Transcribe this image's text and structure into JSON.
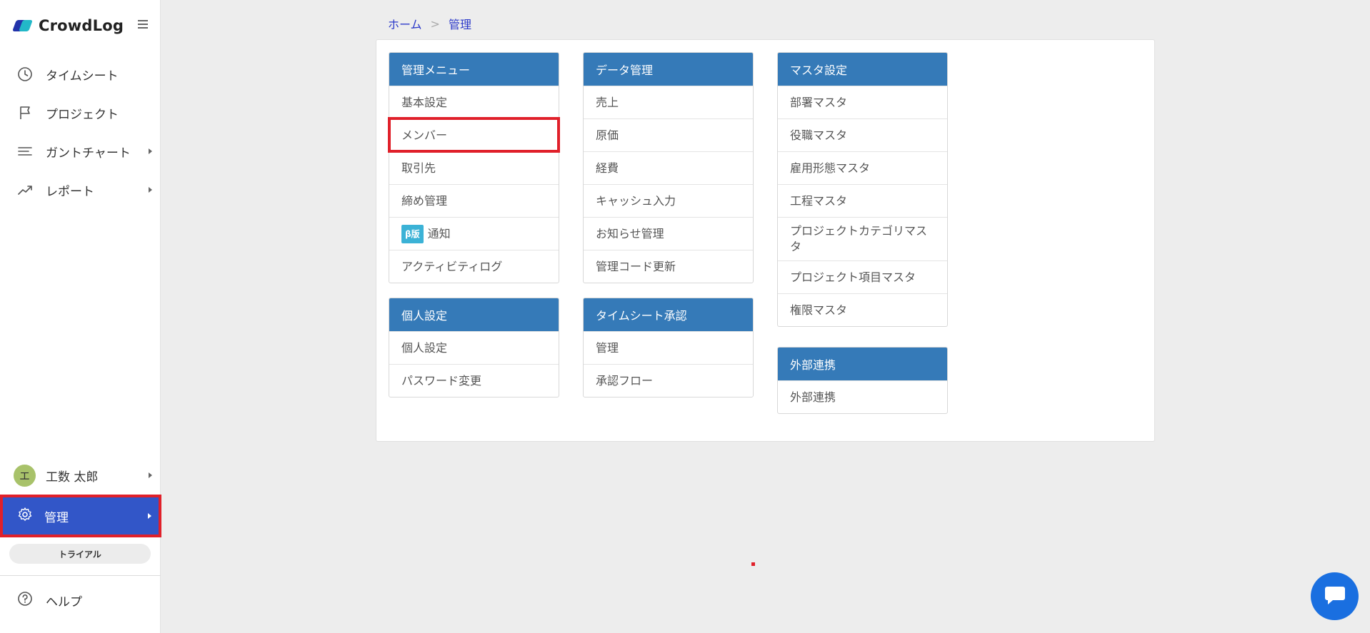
{
  "app": {
    "name": "CrowdLog"
  },
  "sidebar": {
    "items": [
      {
        "label": "タイムシート",
        "icon": "clock-icon"
      },
      {
        "label": "プロジェクト",
        "icon": "flag-icon"
      },
      {
        "label": "ガントチャート",
        "icon": "list-icon"
      },
      {
        "label": "レポート",
        "icon": "trend-up-icon"
      }
    ],
    "user": {
      "initial": "エ",
      "name": "工数 太郎"
    },
    "admin": {
      "label": "管理"
    },
    "trial": "トライアル",
    "help": "ヘルプ"
  },
  "breadcrumb": {
    "home": "ホーム",
    "separator": ">",
    "current": "管理"
  },
  "cards": {
    "admin_menu": {
      "title": "管理メニュー",
      "items": [
        "基本設定",
        "メンバー",
        "取引先",
        "締め管理",
        "通知",
        "アクティビティログ"
      ],
      "beta_badge": "β版"
    },
    "personal": {
      "title": "個人設定",
      "items": [
        "個人設定",
        "パスワード変更"
      ]
    },
    "data_mgmt": {
      "title": "データ管理",
      "items": [
        "売上",
        "原価",
        "経費",
        "キャッシュ入力",
        "お知らせ管理",
        "管理コード更新"
      ]
    },
    "timesheet_approval": {
      "title": "タイムシート承認",
      "items": [
        "管理",
        "承認フロー"
      ]
    },
    "master": {
      "title": "マスタ設定",
      "items": [
        "部署マスタ",
        "役職マスタ",
        "雇用形態マスタ",
        "工程マスタ",
        "プロジェクトカテゴリマスタ",
        "プロジェクト項目マスタ",
        "権限マスタ"
      ]
    },
    "external": {
      "title": "外部連携",
      "items": [
        "外部連携"
      ]
    }
  },
  "colors": {
    "header_blue": "#357ab8",
    "admin_active": "#3256c8",
    "highlight_red": "#e0202a",
    "link_blue": "#2b39c9"
  }
}
